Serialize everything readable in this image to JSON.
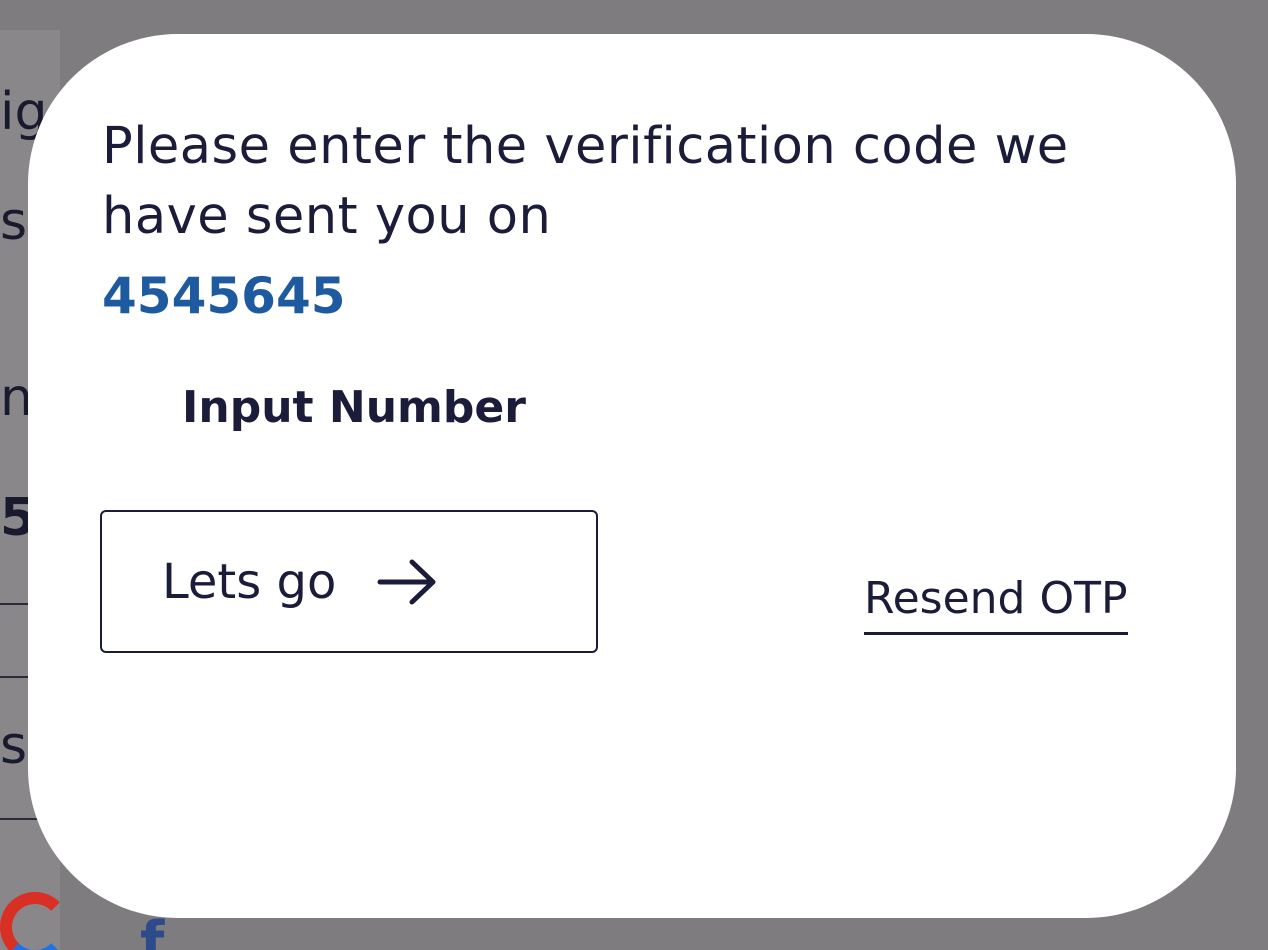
{
  "background": {
    "fragments": [
      "ig",
      "s",
      "n",
      "5",
      "s"
    ],
    "social_f": "f"
  },
  "modal": {
    "message": "Please enter the verification code we have sent you on",
    "phone_number": "4545645",
    "input_placeholder": "Input Number",
    "lets_go_label": "Lets go",
    "resend_label": "Resend OTP"
  },
  "colors": {
    "backdrop": "#7f7c80",
    "text": "#1b1b3a",
    "phone": "#1e5aa0",
    "card": "#ffffff"
  },
  "icons": {
    "lets_go": "arrow-right-icon",
    "google": "google-icon",
    "facebook": "facebook-icon"
  }
}
